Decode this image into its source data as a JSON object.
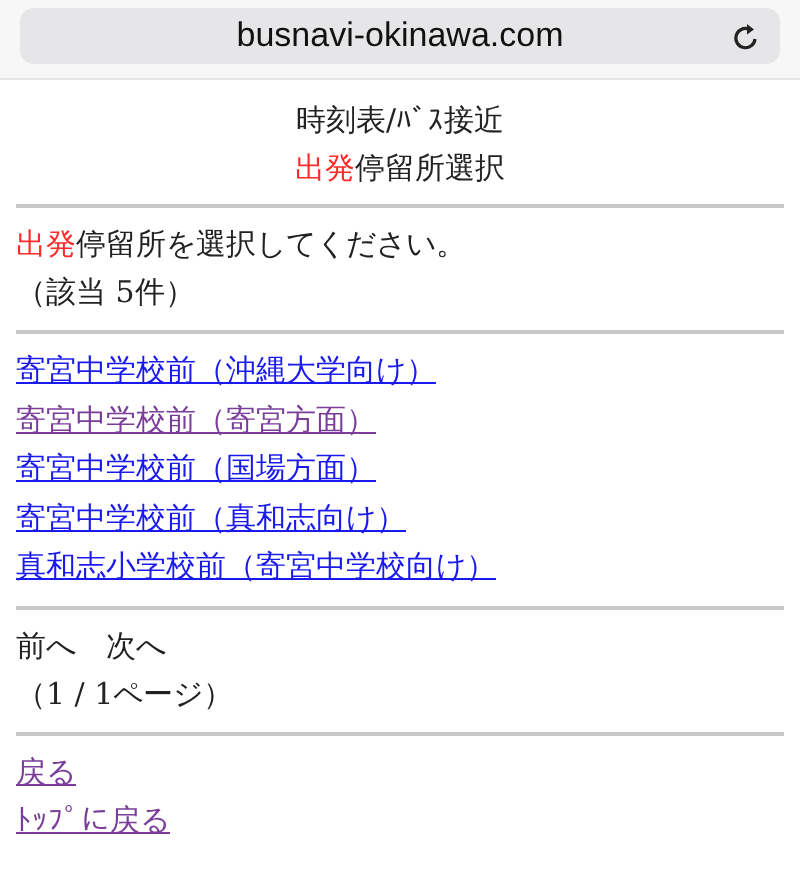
{
  "address_bar": {
    "url": "busnavi-okinawa.com"
  },
  "header": {
    "title": "時刻表/ﾊﾞｽ接近",
    "subtitle_highlight": "出発",
    "subtitle": "停留所選択"
  },
  "instruction": {
    "highlight": "出発",
    "text": "停留所を選択してください。",
    "count": "（該当 5件）"
  },
  "stops": [
    {
      "label": "寄宮中学校前（沖縄大学向け）",
      "visited": false
    },
    {
      "label": "寄宮中学校前（寄宮方面）",
      "visited": true
    },
    {
      "label": "寄宮中学校前（国場方面）",
      "visited": false
    },
    {
      "label": "寄宮中学校前（真和志向け）",
      "visited": false
    },
    {
      "label": "真和志小学校前（寄宮中学校向け）",
      "visited": false
    }
  ],
  "pager": {
    "prev": "前へ",
    "next": "次へ",
    "page": "（1 / 1ページ）"
  },
  "footer_links": [
    {
      "label": "戻る",
      "visited": true
    },
    {
      "label": "ﾄｯﾌﾟに戻る",
      "visited": true
    }
  ]
}
